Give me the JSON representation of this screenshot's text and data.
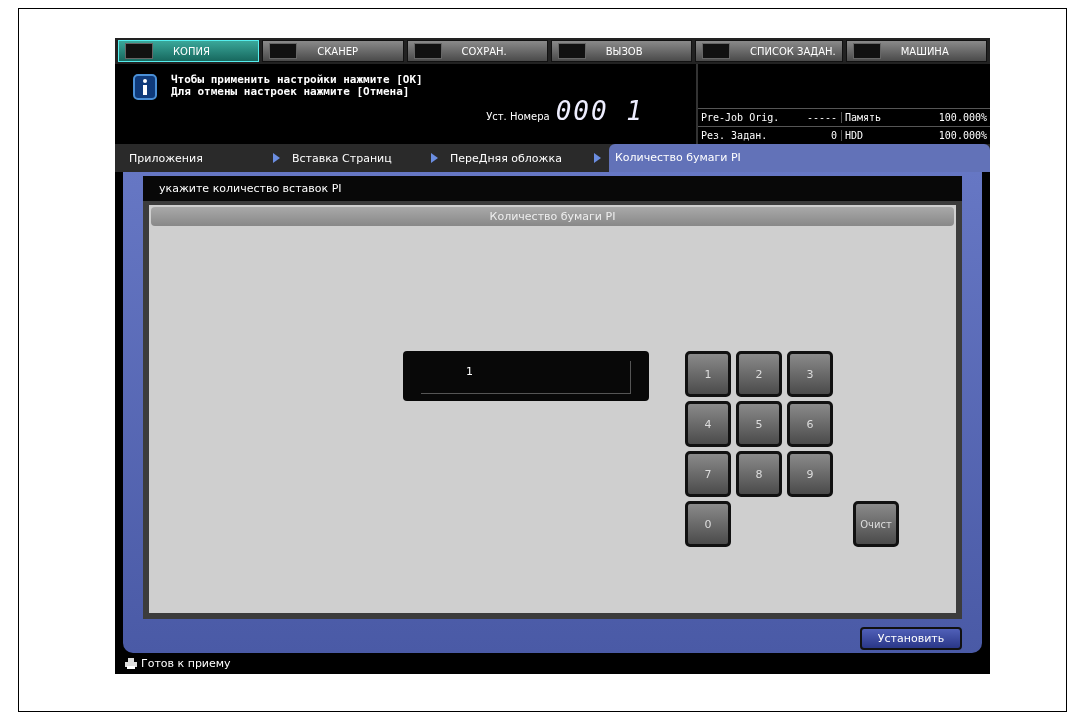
{
  "mode_tabs": [
    {
      "label": "КОПИЯ",
      "selected": true
    },
    {
      "label": "СКАНЕР",
      "selected": false
    },
    {
      "label": "СОХРАН.",
      "selected": false
    },
    {
      "label": "ВЫЗОВ",
      "selected": false
    },
    {
      "label": "СПИСОК ЗАДАН.",
      "selected": false
    },
    {
      "label": "МАШИНА",
      "selected": false
    }
  ],
  "message": {
    "lines": [
      "Чтобы применить настройки нажмите [OK]",
      "Для отмены настроек нажмите [Отмена]"
    ],
    "counter_label": "Уст. Номера",
    "counter": "000 1"
  },
  "status_table": [
    {
      "label": "Pre-Job Orig.",
      "value": "-----",
      "label_2": "Память",
      "value_2": "100.000%"
    },
    {
      "label": "Рез. Задан.",
      "value": "0",
      "label_2": "HDD",
      "value_2": "100.000%"
    }
  ],
  "breadcrumb": [
    {
      "label": "Приложения",
      "selected": false
    },
    {
      "label": "Вставка Страниц",
      "selected": false
    },
    {
      "label": "ПереДняя обложка",
      "selected": false
    },
    {
      "label": "Количество бумаги PI",
      "selected": true
    }
  ],
  "instruction": "укажите количество вставок PI",
  "panel": {
    "title": "Количество бумаги PI",
    "value": "1"
  },
  "keypad": [
    "1",
    "2",
    "3",
    "4",
    "5",
    "6",
    "7",
    "8",
    "9",
    "0"
  ],
  "clear_button": "Очист",
  "set_button": "Установить",
  "status_bar": "Готов к приему"
}
